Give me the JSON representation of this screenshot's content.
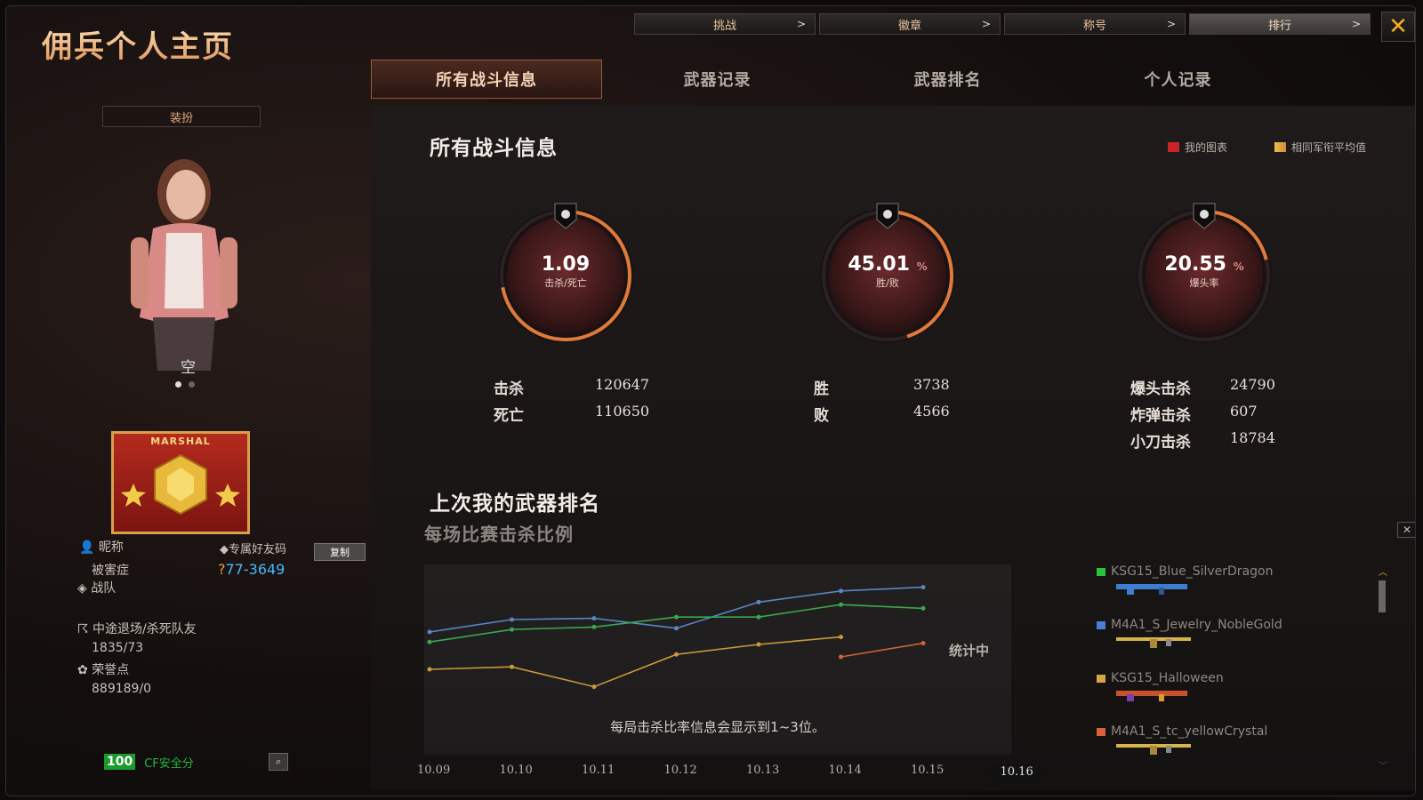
{
  "window": {
    "title": "佣兵个人主页",
    "close_glyph": "✕"
  },
  "top_nav": [
    {
      "label": "挑战",
      "active": false
    },
    {
      "label": "徽章",
      "active": false
    },
    {
      "label": "称号",
      "active": false
    },
    {
      "label": "排行",
      "active": true
    }
  ],
  "tabs": [
    {
      "label": "所有战斗信息",
      "active": true
    },
    {
      "label": "武器记录",
      "active": false
    },
    {
      "label": "武器排名",
      "active": false
    },
    {
      "label": "个人记录",
      "active": false
    }
  ],
  "profile": {
    "dress_label": "装扮",
    "avatar_caption": "空",
    "rank_text": "MARSHAL",
    "nickname_label": "昵称",
    "nickname": "被害症",
    "friend_code_label": "专属好友码",
    "friend_code": "77-3649",
    "copy_label": "复制",
    "team_label": "战队",
    "quit_label": "中途退场/杀死队友",
    "quit_value": "1835/73",
    "honor_label": "荣誉点",
    "honor_value": "889189/0",
    "safety_score": "100",
    "safety_label": "CF安全分"
  },
  "overview": {
    "title": "所有战斗信息",
    "legend": [
      {
        "label": "我的图表",
        "color": "#c8242a"
      },
      {
        "label": "相同军衔平均值",
        "color": "#e8c04a"
      }
    ],
    "stats": [
      {
        "value": "1.09",
        "unit": "",
        "label": "击杀/死亡",
        "fraction": 0.72
      },
      {
        "value": "45.01",
        "unit": "%",
        "label": "胜/败",
        "fraction": 0.45
      },
      {
        "value": "20.55",
        "unit": "%",
        "label": "爆头率",
        "fraction": 0.21
      }
    ],
    "kd": [
      {
        "label": "击杀",
        "value": "120647"
      },
      {
        "label": "死亡",
        "value": "110650"
      }
    ],
    "wl": [
      {
        "label": "胜",
        "value": "3738"
      },
      {
        "label": "败",
        "value": "4566"
      }
    ],
    "special": [
      {
        "label": "爆头击杀",
        "value": "24790"
      },
      {
        "label": "炸弹击杀",
        "value": "607"
      },
      {
        "label": "小刀击杀",
        "value": "18784"
      }
    ]
  },
  "weapon_rank": {
    "title": "上次我的武器排名",
    "subtitle": "每场比赛击杀比例",
    "in_progress": "统计中",
    "note": "每局击杀比率信息会显示到1~3位。",
    "weapons": [
      {
        "name": "KSG15_Blue_SilverDragon",
        "color": "#29c23b"
      },
      {
        "name": "M4A1_S_Jewelry_NobleGold",
        "color": "#4a7ed6"
      },
      {
        "name": "KSG15_Halloween",
        "color": "#d8a44a"
      },
      {
        "name": "M4A1_S_tc_yellowCrystal",
        "color": "#d8623a"
      }
    ]
  },
  "chart_data": {
    "type": "line",
    "categories": [
      "10.09",
      "10.10",
      "10.11",
      "10.12",
      "10.13",
      "10.14",
      "10.15",
      "10.16"
    ],
    "selected_category": "10.16",
    "ylim": [
      0,
      100
    ],
    "grid": false,
    "series": [
      {
        "name": "M4A1_S_Jewelry_NobleGold",
        "color": "#5a86c8",
        "values": [
          60,
          70,
          71,
          63,
          84,
          93,
          96,
          null
        ]
      },
      {
        "name": "KSG15_Blue_SilverDragon",
        "color": "#3aa84e",
        "values": [
          52,
          62,
          64,
          72,
          72,
          82,
          79,
          null
        ]
      },
      {
        "name": "KSG15_Halloween",
        "color": "#c89a3a",
        "values": [
          30,
          32,
          16,
          42,
          50,
          56,
          null,
          null
        ]
      },
      {
        "name": "M4A1_S_tc_yellowCrystal",
        "color": "#d0643a",
        "values": [
          null,
          null,
          null,
          null,
          null,
          40,
          51,
          null
        ]
      }
    ]
  }
}
